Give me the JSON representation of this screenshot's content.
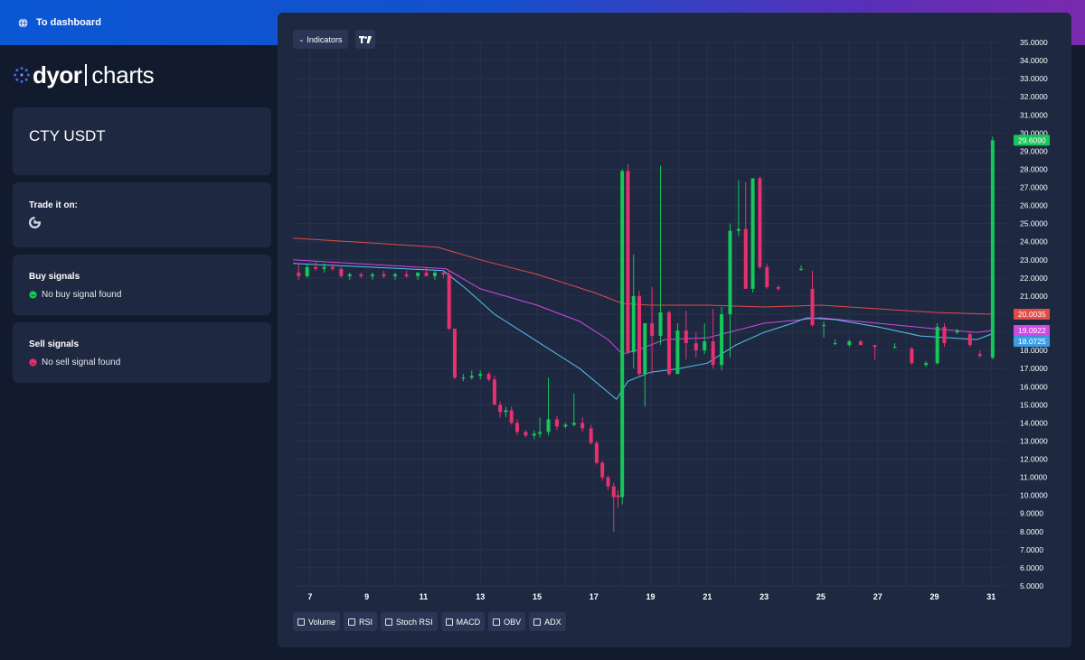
{
  "header": {
    "dashboard_link": "To dashboard",
    "icon": "globe-icon"
  },
  "logo": {
    "word1": "dyor",
    "word2": "charts"
  },
  "pair": {
    "title": "CTY USDT"
  },
  "trade": {
    "title": "Trade it on:",
    "exchange_icon": "gate-io-icon"
  },
  "buy_signals": {
    "title": "Buy signals",
    "status": "No buy signal found",
    "color": "#16c75a"
  },
  "sell_signals": {
    "title": "Sell signals",
    "status": "No sell signal found",
    "color": "#e8306e"
  },
  "toolbar": {
    "indicators_label": "Indicators",
    "caret": "⌄",
    "tradingview_icon": "tradingview-logo-icon"
  },
  "indicator_toggles": [
    "Volume",
    "RSI",
    "Stoch RSI",
    "MACD",
    "OBV",
    "ADX"
  ],
  "chart_data": {
    "type": "candlestick",
    "x_ticks": [
      "7",
      "9",
      "11",
      "13",
      "15",
      "17",
      "19",
      "21",
      "23",
      "25",
      "27",
      "29",
      "31"
    ],
    "y_ticks": [
      "35.0000",
      "34.0000",
      "33.0000",
      "32.0000",
      "31.0000",
      "30.0000",
      "29.0000",
      "28.0000",
      "27.0000",
      "26.0000",
      "25.0000",
      "24.0000",
      "23.0000",
      "22.0000",
      "21.0000",
      "20.0000",
      "19.0000",
      "18.0000",
      "17.0000",
      "16.0000",
      "15.0000",
      "14.0000",
      "13.0000",
      "12.0000",
      "11.0000",
      "10.0000",
      "9.0000",
      "8.0000",
      "7.0000",
      "6.0000",
      "5.0000"
    ],
    "ylim": [
      5,
      35
    ],
    "xlim": [
      6.4,
      31.5
    ],
    "grid": true,
    "colors": {
      "up": "#16c75a",
      "down": "#e8306e"
    },
    "candles": [
      {
        "t": 6.6,
        "o": 22.3,
        "h": 22.8,
        "l": 21.9,
        "c": 22.1
      },
      {
        "t": 6.9,
        "o": 22.1,
        "h": 22.8,
        "l": 22.0,
        "c": 22.6
      },
      {
        "t": 7.2,
        "o": 22.6,
        "h": 22.9,
        "l": 22.4,
        "c": 22.5
      },
      {
        "t": 7.5,
        "o": 22.5,
        "h": 22.8,
        "l": 22.3,
        "c": 22.6
      },
      {
        "t": 7.8,
        "o": 22.6,
        "h": 22.8,
        "l": 22.4,
        "c": 22.5
      },
      {
        "t": 8.1,
        "o": 22.5,
        "h": 22.7,
        "l": 22.0,
        "c": 22.1
      },
      {
        "t": 8.4,
        "o": 22.1,
        "h": 22.3,
        "l": 21.9,
        "c": 22.2
      },
      {
        "t": 8.8,
        "o": 22.2,
        "h": 22.3,
        "l": 22.0,
        "c": 22.1
      },
      {
        "t": 9.2,
        "o": 22.1,
        "h": 22.3,
        "l": 21.9,
        "c": 22.2
      },
      {
        "t": 9.6,
        "o": 22.2,
        "h": 22.4,
        "l": 22.0,
        "c": 22.1
      },
      {
        "t": 10.0,
        "o": 22.1,
        "h": 22.3,
        "l": 21.9,
        "c": 22.2
      },
      {
        "t": 10.4,
        "o": 22.2,
        "h": 22.4,
        "l": 22.0,
        "c": 22.1
      },
      {
        "t": 10.8,
        "o": 22.1,
        "h": 22.3,
        "l": 21.9,
        "c": 22.3
      },
      {
        "t": 11.1,
        "o": 22.3,
        "h": 22.6,
        "l": 22.1,
        "c": 22.1
      },
      {
        "t": 11.4,
        "o": 22.1,
        "h": 22.4,
        "l": 21.9,
        "c": 22.3
      },
      {
        "t": 11.7,
        "o": 22.3,
        "h": 22.4,
        "l": 22.0,
        "c": 22.2
      },
      {
        "t": 11.9,
        "o": 22.2,
        "h": 22.4,
        "l": 19.1,
        "c": 19.2
      },
      {
        "t": 12.1,
        "o": 19.2,
        "h": 19.2,
        "l": 16.4,
        "c": 16.5
      },
      {
        "t": 12.4,
        "o": 16.5,
        "h": 16.7,
        "l": 16.3,
        "c": 16.5
      },
      {
        "t": 12.7,
        "o": 16.5,
        "h": 16.9,
        "l": 16.4,
        "c": 16.6
      },
      {
        "t": 13.0,
        "o": 16.6,
        "h": 16.9,
        "l": 16.4,
        "c": 16.7
      },
      {
        "t": 13.3,
        "o": 16.7,
        "h": 16.8,
        "l": 16.3,
        "c": 16.4
      },
      {
        "t": 13.5,
        "o": 16.4,
        "h": 16.6,
        "l": 15.0,
        "c": 15.0
      },
      {
        "t": 13.7,
        "o": 15.0,
        "h": 15.2,
        "l": 14.3,
        "c": 14.6
      },
      {
        "t": 13.9,
        "o": 14.6,
        "h": 14.9,
        "l": 14.3,
        "c": 14.7
      },
      {
        "t": 14.1,
        "o": 14.7,
        "h": 14.9,
        "l": 13.9,
        "c": 14.0
      },
      {
        "t": 14.3,
        "o": 14.0,
        "h": 14.2,
        "l": 13.3,
        "c": 13.5
      },
      {
        "t": 14.6,
        "o": 13.5,
        "h": 13.6,
        "l": 13.2,
        "c": 13.3
      },
      {
        "t": 14.9,
        "o": 13.3,
        "h": 13.6,
        "l": 13.1,
        "c": 13.4
      },
      {
        "t": 15.1,
        "o": 13.4,
        "h": 14.3,
        "l": 13.2,
        "c": 13.5
      },
      {
        "t": 15.4,
        "o": 13.5,
        "h": 16.5,
        "l": 13.3,
        "c": 14.2
      },
      {
        "t": 15.7,
        "o": 14.2,
        "h": 14.4,
        "l": 13.6,
        "c": 13.8
      },
      {
        "t": 16.0,
        "o": 13.8,
        "h": 14.0,
        "l": 13.7,
        "c": 13.9
      },
      {
        "t": 16.3,
        "o": 13.9,
        "h": 15.6,
        "l": 13.8,
        "c": 14.0
      },
      {
        "t": 16.6,
        "o": 14.0,
        "h": 14.3,
        "l": 13.5,
        "c": 13.7
      },
      {
        "t": 16.9,
        "o": 13.7,
        "h": 13.9,
        "l": 12.8,
        "c": 12.9
      },
      {
        "t": 17.1,
        "o": 12.9,
        "h": 13.0,
        "l": 11.7,
        "c": 11.8
      },
      {
        "t": 17.3,
        "o": 11.8,
        "h": 11.9,
        "l": 10.8,
        "c": 11.0
      },
      {
        "t": 17.5,
        "o": 11.0,
        "h": 11.1,
        "l": 10.3,
        "c": 10.5
      },
      {
        "t": 17.7,
        "o": 10.5,
        "h": 10.7,
        "l": 8.0,
        "c": 9.9
      },
      {
        "t": 17.85,
        "o": 10.0,
        "h": 10.3,
        "l": 9.3,
        "c": 9.9
      },
      {
        "t": 18.0,
        "o": 9.9,
        "h": 28.0,
        "l": 9.5,
        "c": 27.9
      },
      {
        "t": 18.2,
        "o": 27.9,
        "h": 28.3,
        "l": 17.8,
        "c": 17.9
      },
      {
        "t": 18.4,
        "o": 17.9,
        "h": 23.3,
        "l": 17.0,
        "c": 21.0
      },
      {
        "t": 18.6,
        "o": 21.0,
        "h": 21.3,
        "l": 16.6,
        "c": 16.7
      },
      {
        "t": 18.8,
        "o": 16.7,
        "h": 19.5,
        "l": 14.9,
        "c": 19.5
      },
      {
        "t": 19.05,
        "o": 19.5,
        "h": 21.5,
        "l": 16.7,
        "c": 18.8
      },
      {
        "t": 19.35,
        "o": 18.8,
        "h": 28.2,
        "l": 18.3,
        "c": 20.1
      },
      {
        "t": 19.65,
        "o": 20.1,
        "h": 20.2,
        "l": 16.6,
        "c": 16.7
      },
      {
        "t": 19.95,
        "o": 16.7,
        "h": 19.5,
        "l": 16.7,
        "c": 19.1
      },
      {
        "t": 20.25,
        "o": 19.1,
        "h": 20.2,
        "l": 17.5,
        "c": 18.4
      },
      {
        "t": 20.6,
        "o": 18.4,
        "h": 19.0,
        "l": 17.6,
        "c": 18.0
      },
      {
        "t": 20.9,
        "o": 18.0,
        "h": 19.5,
        "l": 17.8,
        "c": 18.5
      },
      {
        "t": 21.2,
        "o": 18.5,
        "h": 20.3,
        "l": 17.0,
        "c": 17.2
      },
      {
        "t": 21.5,
        "o": 17.2,
        "h": 20.4,
        "l": 16.9,
        "c": 20.0
      },
      {
        "t": 21.8,
        "o": 20.0,
        "h": 25.0,
        "l": 17.6,
        "c": 24.6
      },
      {
        "t": 22.1,
        "o": 24.6,
        "h": 27.4,
        "l": 24.3,
        "c": 24.7
      },
      {
        "t": 22.35,
        "o": 24.7,
        "h": 27.3,
        "l": 24.5,
        "c": 21.4
      },
      {
        "t": 22.6,
        "o": 21.4,
        "h": 27.5,
        "l": 21.2,
        "c": 27.5
      },
      {
        "t": 22.85,
        "o": 27.5,
        "h": 27.6,
        "l": 22.5,
        "c": 22.6
      },
      {
        "t": 23.1,
        "o": 22.6,
        "h": 22.8,
        "l": 21.4,
        "c": 21.5
      },
      {
        "t": 23.5,
        "o": 21.5,
        "h": 21.6,
        "l": 21.3,
        "c": 21.4
      },
      {
        "t": 24.3,
        "o": 22.5,
        "h": 22.7,
        "l": 22.4,
        "c": 22.5
      },
      {
        "t": 24.7,
        "o": 21.4,
        "h": 22.4,
        "l": 19.3,
        "c": 19.4
      },
      {
        "t": 25.1,
        "o": 19.4,
        "h": 19.6,
        "l": 18.7,
        "c": 19.4
      },
      {
        "t": 25.5,
        "o": 18.4,
        "h": 18.6,
        "l": 18.3,
        "c": 18.4
      },
      {
        "t": 26.0,
        "o": 18.3,
        "h": 18.6,
        "l": 18.2,
        "c": 18.5
      },
      {
        "t": 26.4,
        "o": 18.5,
        "h": 18.6,
        "l": 18.3,
        "c": 18.3
      },
      {
        "t": 26.9,
        "o": 18.3,
        "h": 18.3,
        "l": 17.5,
        "c": 18.2
      },
      {
        "t": 27.6,
        "o": 18.2,
        "h": 18.4,
        "l": 18.1,
        "c": 18.2
      },
      {
        "t": 28.2,
        "o": 18.1,
        "h": 18.2,
        "l": 17.2,
        "c": 17.3
      },
      {
        "t": 28.7,
        "o": 17.2,
        "h": 17.4,
        "l": 17.1,
        "c": 17.3
      },
      {
        "t": 29.1,
        "o": 17.3,
        "h": 19.5,
        "l": 17.2,
        "c": 19.3
      },
      {
        "t": 29.35,
        "o": 19.3,
        "h": 19.5,
        "l": 18.2,
        "c": 18.4
      },
      {
        "t": 29.8,
        "o": 19.0,
        "h": 19.2,
        "l": 18.9,
        "c": 19.1
      },
      {
        "t": 30.25,
        "o": 18.9,
        "h": 19.0,
        "l": 18.2,
        "c": 18.3
      },
      {
        "t": 30.6,
        "o": 17.8,
        "h": 18.0,
        "l": 17.6,
        "c": 17.7
      },
      {
        "t": 31.05,
        "o": 17.6,
        "h": 29.8,
        "l": 17.5,
        "c": 29.6
      }
    ],
    "ma_lines": [
      {
        "color": "#e04c48",
        "points": [
          [
            6.4,
            24.2
          ],
          [
            11.5,
            23.7
          ],
          [
            13,
            23.0
          ],
          [
            15,
            22.2
          ],
          [
            17,
            21.2
          ],
          [
            18.0,
            20.6
          ],
          [
            19,
            20.5
          ],
          [
            21,
            20.5
          ],
          [
            23,
            20.4
          ],
          [
            25,
            20.5
          ],
          [
            27,
            20.3
          ],
          [
            29,
            20.1
          ],
          [
            31,
            20.0
          ]
        ]
      },
      {
        "color": "#cf49e6",
        "points": [
          [
            6.4,
            23.0
          ],
          [
            11.8,
            22.5
          ],
          [
            13,
            21.4
          ],
          [
            15,
            20.5
          ],
          [
            16.5,
            19.6
          ],
          [
            17.5,
            18.6
          ],
          [
            18.0,
            17.8
          ],
          [
            18.5,
            18.0
          ],
          [
            19.5,
            18.6
          ],
          [
            21,
            18.7
          ],
          [
            22,
            19.1
          ],
          [
            23,
            19.5
          ],
          [
            25,
            19.8
          ],
          [
            27,
            19.5
          ],
          [
            29,
            19.2
          ],
          [
            30.5,
            19.0
          ],
          [
            31,
            19.1
          ]
        ]
      },
      {
        "color": "#58c3ee",
        "points": [
          [
            6.4,
            22.8
          ],
          [
            11.7,
            22.4
          ],
          [
            12.5,
            21.4
          ],
          [
            13.5,
            20.0
          ],
          [
            15,
            18.5
          ],
          [
            16.5,
            17.0
          ],
          [
            17.8,
            15.3
          ],
          [
            18.2,
            16.3
          ],
          [
            19,
            16.8
          ],
          [
            20,
            17.0
          ],
          [
            21,
            17.3
          ],
          [
            22,
            18.3
          ],
          [
            23,
            19.0
          ],
          [
            24,
            19.5
          ],
          [
            24.5,
            19.8
          ],
          [
            25.5,
            19.7
          ],
          [
            27,
            19.3
          ],
          [
            28.5,
            18.8
          ],
          [
            29.5,
            18.7
          ],
          [
            30.5,
            18.6
          ],
          [
            31,
            18.9
          ]
        ]
      }
    ],
    "price_labels": [
      {
        "text": "29.6090",
        "value": 29.6,
        "color": "#16c75a"
      },
      {
        "text": "20.0035",
        "value": 20.0,
        "color": "#e04c48"
      },
      {
        "text": "19.0922",
        "value": 19.1,
        "color": "#cf49e6"
      },
      {
        "text": "18.0725",
        "value": 18.5,
        "color": "#3d9ee6"
      }
    ]
  }
}
